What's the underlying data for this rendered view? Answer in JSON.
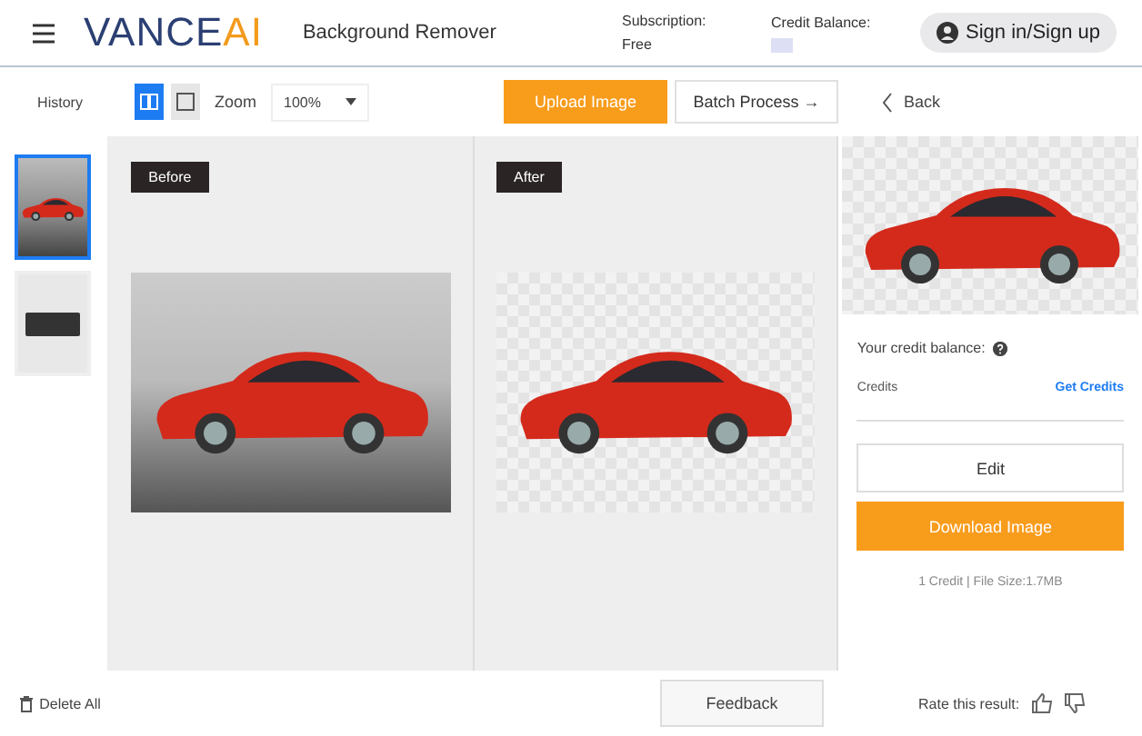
{
  "header": {
    "logo_main": "VANCE",
    "logo_accent": "AI",
    "product": "Background Remover",
    "subscription_label": "Subscription:",
    "subscription_value": "Free",
    "credit_label": "Credit Balance:",
    "sign_in": "Sign in/Sign up"
  },
  "toolbar": {
    "history": "History",
    "views": [
      {
        "kind": "split",
        "selected": true
      },
      {
        "kind": "single",
        "selected": false
      }
    ],
    "zoom_label": "Zoom",
    "zoom_value": "100%",
    "upload": "Upload Image",
    "batch": "Batch Process →",
    "back": "Back"
  },
  "thumbnails": [
    {
      "kind": "car",
      "selected": true
    },
    {
      "kind": "keyboard",
      "selected": false
    }
  ],
  "delete_all": "Delete All",
  "panes": [
    {
      "kind": "before",
      "tag": "Before"
    },
    {
      "kind": "after",
      "tag": "After"
    }
  ],
  "result": {
    "credit_balance": "Your credit balance:",
    "credits": "Credits",
    "get_credits": "Get Credits",
    "edit": "Edit",
    "download": "Download Image",
    "file_info": "1 Credit | File Size:1.7MB",
    "rate": "Rate this result:"
  },
  "feedback": "Feedback"
}
